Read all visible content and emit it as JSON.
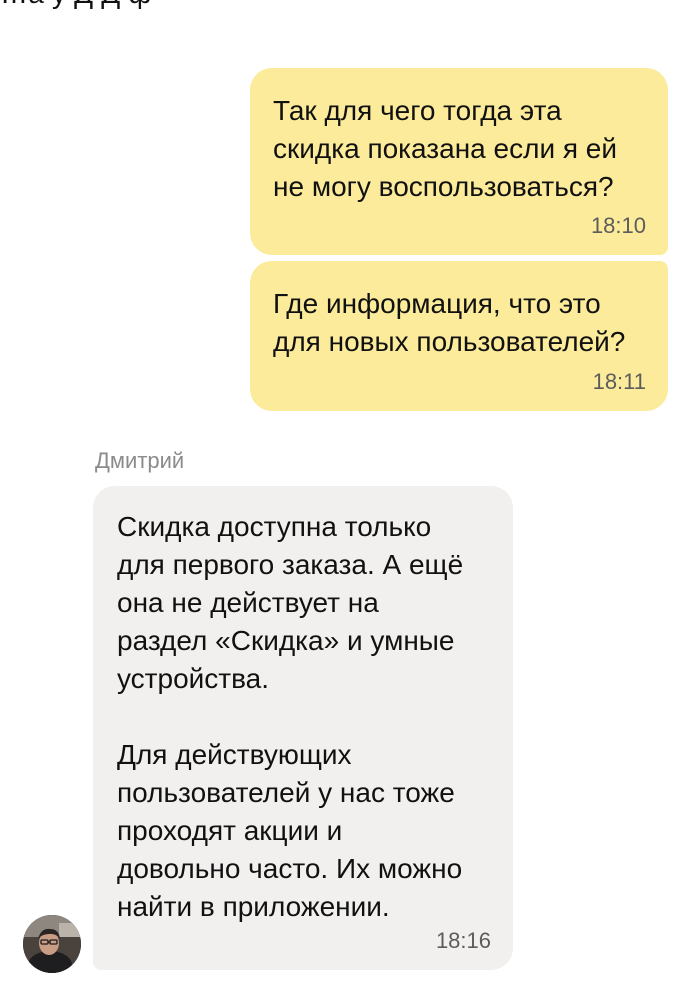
{
  "header": {
    "cut_text": "…а    у         Д Д  ф"
  },
  "messages": [
    {
      "direction": "outgoing",
      "text": "Так для чего тогда эта\nскидка показана если я ей\nне могу воспользоваться?",
      "time": "18:10"
    },
    {
      "direction": "outgoing",
      "text": "Где информация, что это\nдля новых пользователей?",
      "time": "18:11"
    },
    {
      "direction": "incoming",
      "sender": "Дмитрий",
      "text": "Скидка доступна только\nдля первого заказа. А ещё\nона не действует на\nраздел «Скидка» и умные\nустройства.\n\nДля действующих\nпользователей у нас тоже\nпроходят акции и\nдовольно часто. Их можно\nнайти в приложении.",
      "time": "18:16"
    }
  ],
  "colors": {
    "outgoing_bubble": "#fbeb9a",
    "incoming_bubble": "#f2f0ee",
    "time_text": "#5c5c5c",
    "sender_name": "#8b8b8b"
  },
  "icons": {
    "avatar": "user-photo-avatar"
  }
}
